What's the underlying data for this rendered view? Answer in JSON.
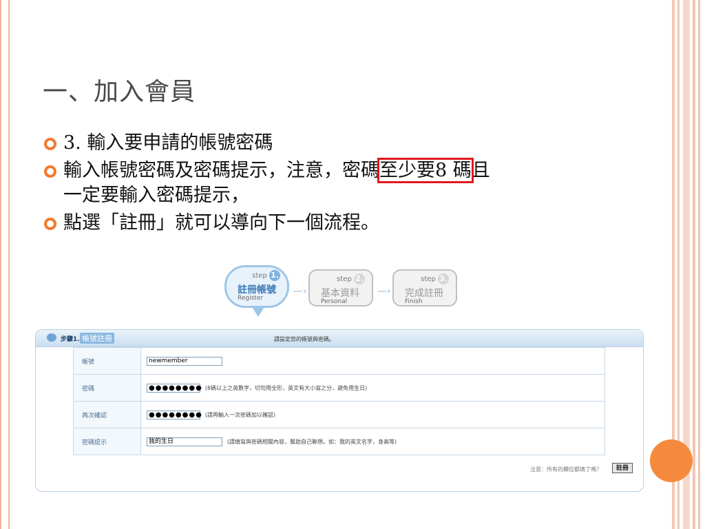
{
  "slide": {
    "title": "一、加入會員",
    "bullets": [
      {
        "text": "3. 輸入要申請的帳號密碼"
      },
      {
        "line1_before": "輸入帳號密碼及密碼提示，注意，密碼",
        "line1_highlight": "至少要8 碼",
        "line1_after": "且",
        "line2": "一定要輸入密碼提示，"
      },
      {
        "text": "點選「註冊」就可以導向下一個流程。"
      }
    ],
    "colors": {
      "accent": "#f27a2a",
      "highlight_box": "#e0171d"
    }
  },
  "steps": [
    {
      "step_word": "step",
      "num": "1.",
      "title": "註冊帳號",
      "subtitle": "Register",
      "active": true
    },
    {
      "step_word": "step",
      "num": "2.",
      "title": "基本資料",
      "subtitle": "Personal",
      "active": false
    },
    {
      "step_word": "step",
      "num": "3.",
      "title": "完成註冊",
      "subtitle": "Finish",
      "active": false
    }
  ],
  "form": {
    "step_label": "步驟1.",
    "step_title": "帳號註冊",
    "prompt": "請設定您的帳號與密碼。",
    "rows": [
      {
        "label": "帳號",
        "value": "newmember",
        "hint": ""
      },
      {
        "label": "密碼",
        "value": "●●●●●●●●",
        "hint": "(8碼以上之英數字，切勿用全形，英文有大小寫之分，避免用生日)"
      },
      {
        "label": "再次確認",
        "value": "●●●●●●●●",
        "hint": "(請再輸入一次密碼加以確認)"
      },
      {
        "label": "密碼提示",
        "value": "我的生日",
        "hint": "(請填寫與密碼相關內容，幫助自己聯想。如：我的英文名字，身高等)"
      }
    ],
    "notice": "注意：所有的欄位都填了嗎？",
    "submit_label": "註冊"
  }
}
